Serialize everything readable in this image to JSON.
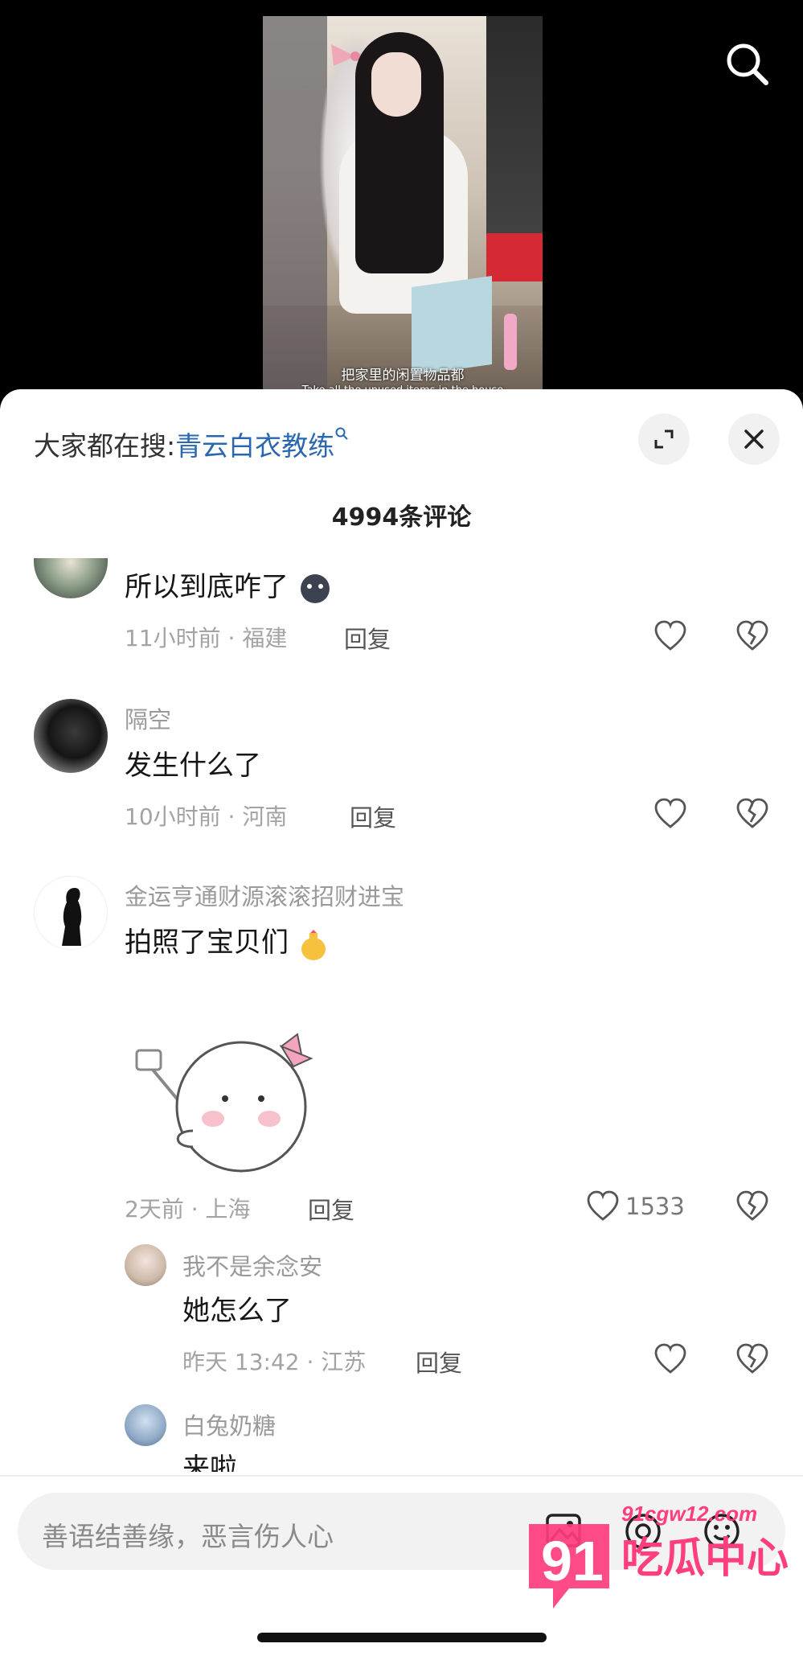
{
  "video": {
    "subtitle_cn": "把家里的闲置物品都",
    "subtitle_en": "Take all the unused items in the house"
  },
  "header": {
    "hot_search_prefix": "大家都在搜:",
    "hot_search_term": "青云白衣教练"
  },
  "comment_count": "4994条评论",
  "comments": [
    {
      "author": "",
      "text": "所以到底咋了",
      "time_location": "11小时前 · 福建",
      "reply_label": "回复",
      "likes": ""
    },
    {
      "author": "隔空",
      "text": "发生什么了",
      "time_location": "10小时前 · 河南",
      "reply_label": "回复",
      "likes": ""
    },
    {
      "author": "金运亨通财源滚滚招财进宝",
      "text": "拍照了宝贝们",
      "time_location": "2天前 · 上海",
      "reply_label": "回复",
      "likes": "1533"
    }
  ],
  "replies": [
    {
      "author": "我不是余念安",
      "text": "她怎么了",
      "time_location": "昨天 13:42 · 江苏",
      "reply_label": "回复"
    },
    {
      "author": "白兔奶糖",
      "text": "来啦"
    }
  ],
  "input": {
    "placeholder": "善语结善缘，恶言伤人心"
  },
  "watermark": {
    "number": "91",
    "text": "吃瓜中心",
    "url": "91cgw12.com"
  },
  "colors": {
    "accent_link": "#2a67b0",
    "watermark_pink": "#ff3d7f"
  }
}
